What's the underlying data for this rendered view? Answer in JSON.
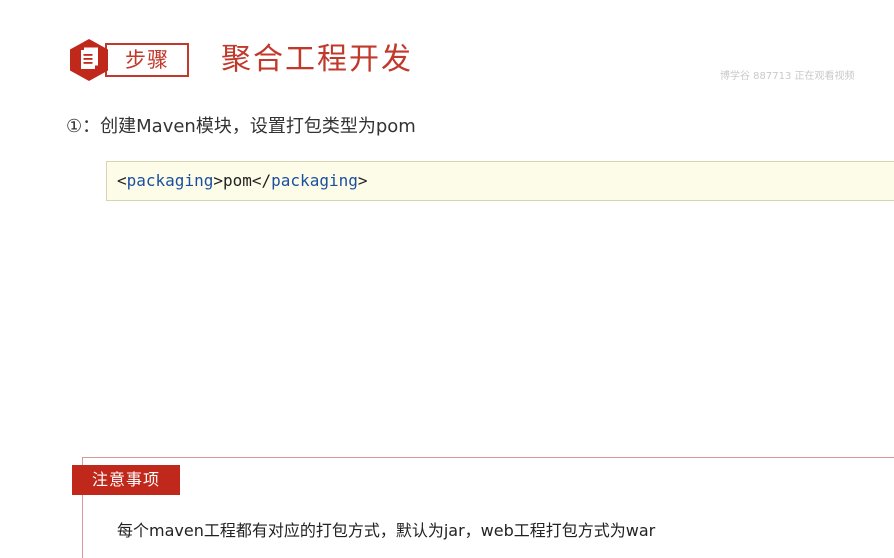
{
  "header": {
    "step_badge_label": "步骤",
    "title": "聚合工程开发",
    "watermark": "博学谷 887713 正在观看视频"
  },
  "step": {
    "number": "①",
    "text": "：创建Maven模块，设置打包类型为pom"
  },
  "code": {
    "open_lt": "<",
    "open_tag": "packaging",
    "open_gt": ">",
    "value": "pom",
    "close_lt": "</",
    "close_tag": "packaging",
    "close_gt": ">"
  },
  "note": {
    "tag_label": "注意事项",
    "text": "每个maven工程都有对应的打包方式，默认为jar，web工程打包方式为war"
  },
  "colors": {
    "accent": "#c0392b",
    "note_tag_bg": "#c0281c",
    "code_bg": "#fdfce8",
    "code_tag": "#1a4fa0"
  },
  "icons": {
    "step_icon": "document-icon"
  }
}
